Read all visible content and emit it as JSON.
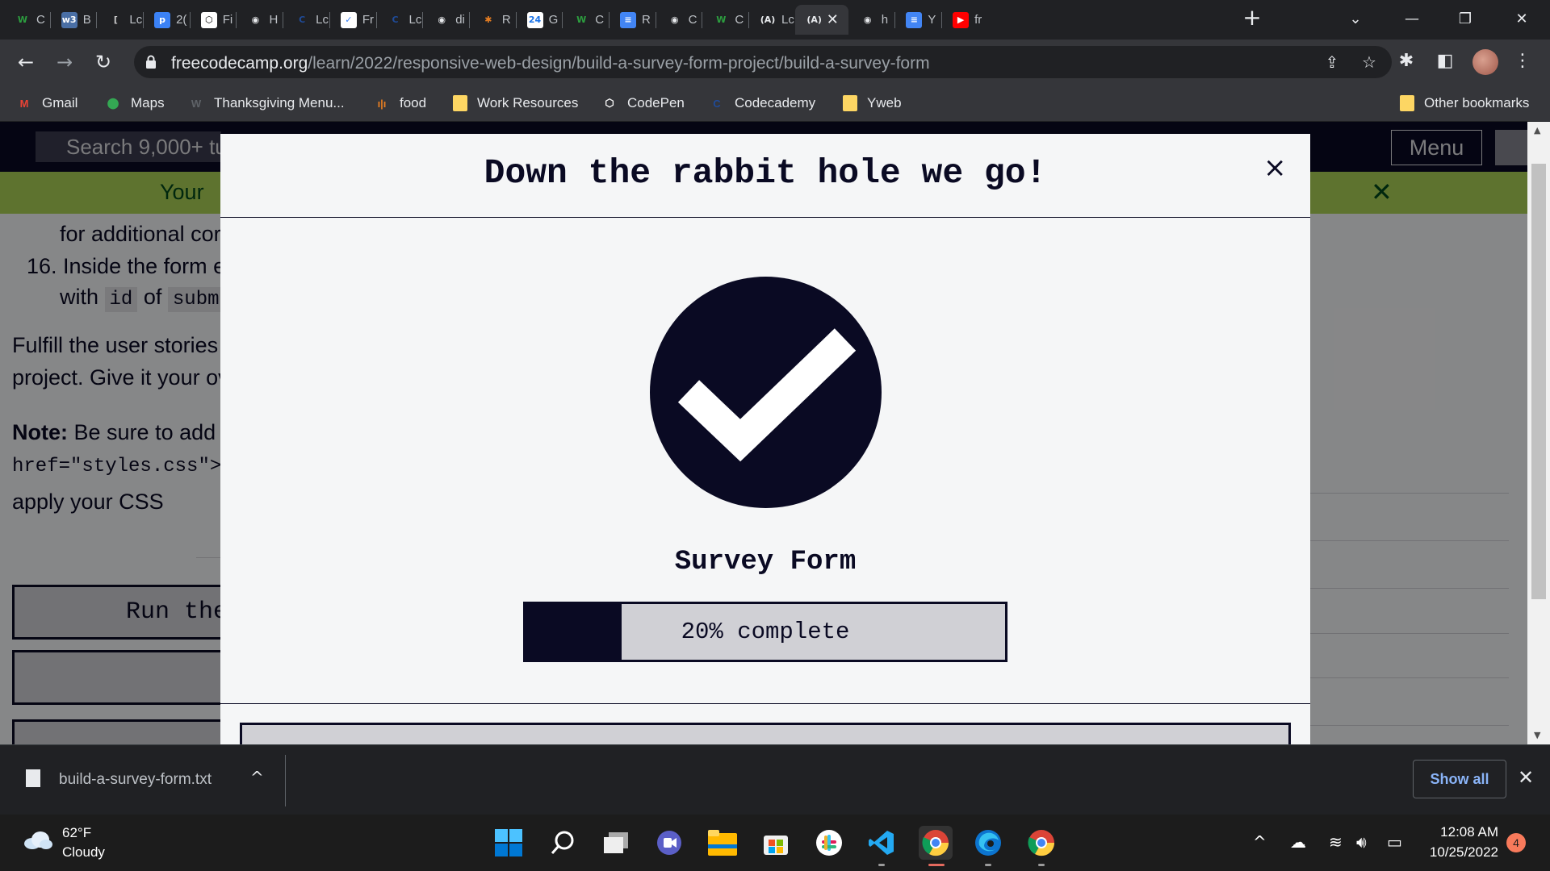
{
  "browser": {
    "tabs": [
      {
        "label": "C",
        "favicon_text": "W",
        "favicon_color": "#2c9e3f",
        "favicon_bg": "transparent"
      },
      {
        "label": "B",
        "favicon_text": "w3",
        "favicon_color": "#ffffff",
        "favicon_bg": "#4a6fa5"
      },
      {
        "label": "Lc",
        "favicon_text": "[",
        "favicon_color": "#cccccc",
        "favicon_bg": "transparent"
      },
      {
        "label": "2(",
        "favicon_text": "p",
        "favicon_color": "#ffffff",
        "favicon_bg": "#3b82f6"
      },
      {
        "label": "Fi",
        "favicon_text": "⬡",
        "favicon_color": "#000000",
        "favicon_bg": "#ffffff"
      },
      {
        "label": "H",
        "favicon_text": "◉",
        "favicon_color": "#e8eaed",
        "favicon_bg": "transparent"
      },
      {
        "label": "Lc",
        "favicon_text": "C",
        "favicon_color": "#1f4b99",
        "favicon_bg": "transparent"
      },
      {
        "label": "Fr",
        "favicon_text": "✓",
        "favicon_color": "#3b82f6",
        "favicon_bg": "#ffffff"
      },
      {
        "label": "Lc",
        "favicon_text": "C",
        "favicon_color": "#1f4b99",
        "favicon_bg": "transparent"
      },
      {
        "label": "di",
        "favicon_text": "◉",
        "favicon_color": "#e8eaed",
        "favicon_bg": "transparent"
      },
      {
        "label": "R",
        "favicon_text": "✱",
        "favicon_color": "#e67e22",
        "favicon_bg": "transparent"
      },
      {
        "label": "G",
        "favicon_text": "24",
        "favicon_color": "#1a73e8",
        "favicon_bg": "#ffffff"
      },
      {
        "label": "C",
        "favicon_text": "W",
        "favicon_color": "#2c9e3f",
        "favicon_bg": "transparent"
      },
      {
        "label": "R",
        "favicon_text": "≡",
        "favicon_color": "#ffffff",
        "favicon_bg": "#4285f4"
      },
      {
        "label": "C",
        "favicon_text": "◉",
        "favicon_color": "#e8eaed",
        "favicon_bg": "transparent"
      },
      {
        "label": "C",
        "favicon_text": "W",
        "favicon_color": "#2c9e3f",
        "favicon_bg": "transparent"
      },
      {
        "label": "Lc",
        "favicon_text": "(A)",
        "favicon_color": "#e8eaed",
        "favicon_bg": "transparent"
      },
      {
        "label": "",
        "favicon_text": "(A)",
        "favicon_color": "#e8eaed",
        "favicon_bg": "transparent",
        "active": true
      },
      {
        "label": "h",
        "favicon_text": "◉",
        "favicon_color": "#e8eaed",
        "favicon_bg": "transparent"
      },
      {
        "label": "Y",
        "favicon_text": "≡",
        "favicon_color": "#ffffff",
        "favicon_bg": "#4285f4"
      },
      {
        "label": "fr",
        "favicon_text": "▶",
        "favicon_color": "#ffffff",
        "favicon_bg": "#ff0000"
      }
    ],
    "tab_close_glyph": "✕",
    "new_tab_glyph": "+",
    "url_host": "freecodecamp.org",
    "url_path": "/learn/2022/responsive-web-design/build-a-survey-form-project/build-a-survey-form",
    "bookmarks": [
      {
        "label": "Gmail",
        "icon": "gmail-icon",
        "icon_text": "M",
        "icon_color": "#ea4335"
      },
      {
        "label": "Maps",
        "icon": "maps-icon",
        "icon_text": "⬤",
        "icon_color": "#34a853"
      },
      {
        "label": "Thanksgiving Menu...",
        "icon": "wix-icon",
        "icon_text": "W",
        "icon_color": "#5f6368"
      },
      {
        "label": "food",
        "icon": "food-icon",
        "icon_text": "ı|ı",
        "icon_color": "#e67e22"
      },
      {
        "label": "Work Resources",
        "icon": "folder-icon",
        "icon_text": "",
        "icon_color": "#fdd663"
      },
      {
        "label": "CodePen",
        "icon": "codepen-icon",
        "icon_text": "⬡",
        "icon_color": "#ffffff"
      },
      {
        "label": "Codecademy",
        "icon": "codecademy-icon",
        "icon_text": "C",
        "icon_color": "#1f4b99"
      },
      {
        "label": "Yweb",
        "icon": "folder-icon",
        "icon_text": "",
        "icon_color": "#fdd663"
      }
    ],
    "other_bookmarks": "Other bookmarks"
  },
  "fcc": {
    "search_placeholder": "Search 9,000+ tu",
    "menu_label": "Menu",
    "banner_text": "Your",
    "banner_close": "✕",
    "content": {
      "line1": "for additional cor",
      "line2_num": "16. Inside the form e",
      "line3_a": "with",
      "line3_code1": "id",
      "line3_b": "of",
      "line3_code2": "subm",
      "para1_line1": "Fulfill the user stories",
      "para1_line2": "project. Give it your ov",
      "note_label": "Note:",
      "note_text": "Be sure to add",
      "note_code_a": "<",
      "note_code_line2": "href=\"styles.css\">",
      "note_line3": "apply your CSS",
      "run_button": "Run the"
    }
  },
  "modal": {
    "title": "Down the rabbit hole we go!",
    "close": "×",
    "challenge_name": "Survey Form",
    "progress_percent": 20,
    "progress_text": "20% complete"
  },
  "downloads": {
    "file_name": "build-a-survey-form.txt",
    "chevron": "^",
    "show_all": "Show all",
    "close": "✕"
  },
  "taskbar": {
    "weather_temp": "62°F",
    "weather_desc": "Cloudy",
    "time": "12:08 AM",
    "date": "10/25/2022",
    "notification_count": "4"
  }
}
